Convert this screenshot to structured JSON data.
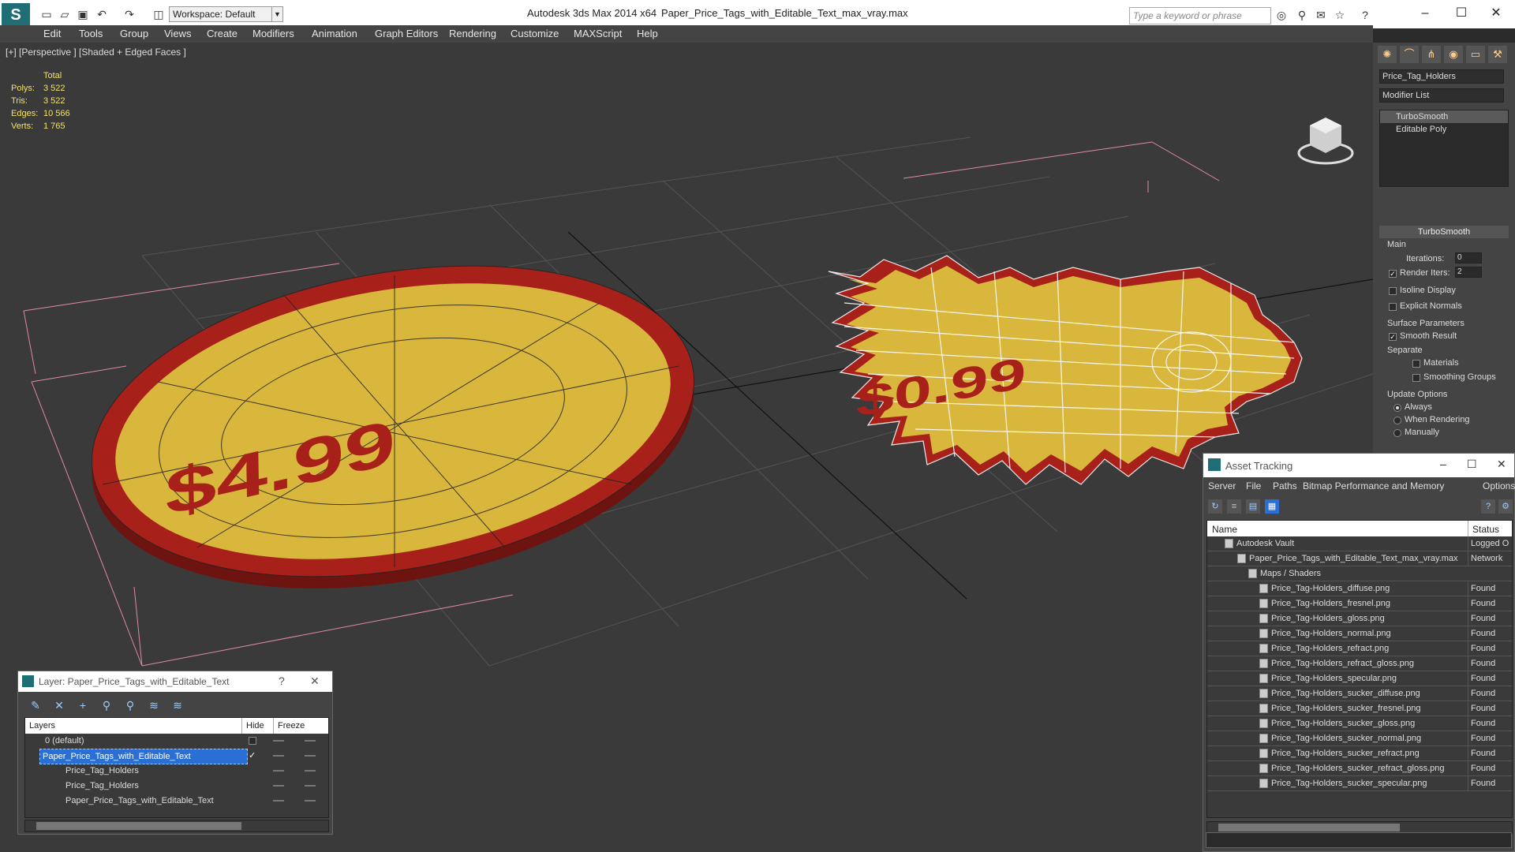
{
  "titlebar": {
    "app_title": "Autodesk 3ds Max  2014 x64",
    "file_name": "Paper_Price_Tags_with_Editable_Text_max_vray.max",
    "workspace": "Workspace: Default",
    "search_placeholder": "Type a keyword or phrase"
  },
  "menu": [
    "Edit",
    "Tools",
    "Group",
    "Views",
    "Create",
    "Modifiers",
    "Animation",
    "Graph Editors",
    "Rendering",
    "Customize",
    "MAXScript",
    "Help"
  ],
  "viewport": {
    "label": "[+] [Perspective ] [Shaded + Edged Faces ]",
    "stats": {
      "header": "Total",
      "rows": [
        {
          "k": "Polys:",
          "v": "3 522"
        },
        {
          "k": "Tris:",
          "v": "3 522"
        },
        {
          "k": "Edges:",
          "v": "10 566"
        },
        {
          "k": "Verts:",
          "v": "1 765"
        }
      ]
    },
    "tag_left_text": "$4.99",
    "tag_right_text": "$0.99",
    "colors": {
      "tag_yellow": "#d9b63c",
      "tag_red": "#a8201a",
      "grid": "#555555",
      "bbox": "#e08aa8"
    }
  },
  "command_panel": {
    "object_name": "Price_Tag_Holders",
    "modifier_list": "Modifier List",
    "stack": [
      "TurboSmooth",
      "Editable Poly"
    ],
    "rollout": "TurboSmooth",
    "main_label": "Main",
    "iterations_label": "Iterations:",
    "iterations_value": "0",
    "render_iters_label": "Render Iters:",
    "render_iters_value": "2",
    "isoline_label": "Isoline Display",
    "explicit_label": "Explicit Normals",
    "surface_label": "Surface Parameters",
    "smooth_label": "Smooth Result",
    "separate_label": "Separate",
    "materials_label": "Materials",
    "smoothing_label": "Smoothing Groups",
    "update_label": "Update Options",
    "always_label": "Always",
    "when_render_label": "When Rendering",
    "manually_label": "Manually"
  },
  "asset_tracking": {
    "title": "Asset Tracking",
    "menu": [
      "Server",
      "File",
      "Paths",
      "Bitmap Performance and Memory",
      "Options"
    ],
    "col_name": "Name",
    "col_status": "Status",
    "rows": [
      {
        "name": "Autodesk Vault",
        "status": "Logged O"
      },
      {
        "name": "Paper_Price_Tags_with_Editable_Text_max_vray.max",
        "status": "Network"
      },
      {
        "name": "Maps / Shaders",
        "status": ""
      },
      {
        "name": "Price_Tag-Holders_diffuse.png",
        "status": "Found"
      },
      {
        "name": "Price_Tag-Holders_fresnel.png",
        "status": "Found"
      },
      {
        "name": "Price_Tag-Holders_gloss.png",
        "status": "Found"
      },
      {
        "name": "Price_Tag-Holders_normal.png",
        "status": "Found"
      },
      {
        "name": "Price_Tag-Holders_refract.png",
        "status": "Found"
      },
      {
        "name": "Price_Tag-Holders_refract_gloss.png",
        "status": "Found"
      },
      {
        "name": "Price_Tag-Holders_specular.png",
        "status": "Found"
      },
      {
        "name": "Price_Tag-Holders_sucker_diffuse.png",
        "status": "Found"
      },
      {
        "name": "Price_Tag-Holders_sucker_fresnel.png",
        "status": "Found"
      },
      {
        "name": "Price_Tag-Holders_sucker_gloss.png",
        "status": "Found"
      },
      {
        "name": "Price_Tag-Holders_sucker_normal.png",
        "status": "Found"
      },
      {
        "name": "Price_Tag-Holders_sucker_refract.png",
        "status": "Found"
      },
      {
        "name": "Price_Tag-Holders_sucker_refract_gloss.png",
        "status": "Found"
      },
      {
        "name": "Price_Tag-Holders_sucker_specular.png",
        "status": "Found"
      }
    ]
  },
  "layer_panel": {
    "title": "Layer: Paper_Price_Tags_with_Editable_Text",
    "help": "?",
    "col_layers": "Layers",
    "col_hide": "Hide",
    "col_freeze": "Freeze",
    "rows": [
      {
        "name": "0 (default)"
      },
      {
        "name": "Paper_Price_Tags_with_Editable_Text"
      },
      {
        "name": "Price_Tag_Holders"
      },
      {
        "name": "Price_Tag_Holders"
      },
      {
        "name": "Paper_Price_Tags_with_Editable_Text"
      }
    ]
  }
}
